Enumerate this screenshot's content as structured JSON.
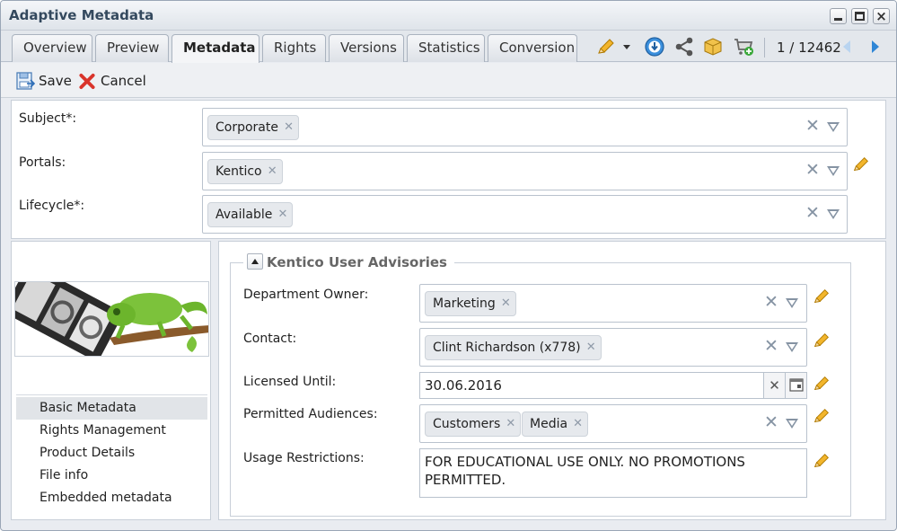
{
  "window": {
    "title": "Adaptive Metadata"
  },
  "tabs": [
    "Overview",
    "Preview",
    "Metadata",
    "Rights",
    "Versions",
    "Statistics",
    "Conversion"
  ],
  "active_tab": "Metadata",
  "pager": {
    "text": "1 / 12462"
  },
  "toolbar": {
    "save_label": "Save",
    "cancel_label": "Cancel"
  },
  "top_fields": {
    "subject": {
      "label": "Subject*:",
      "tags": [
        "Corporate"
      ]
    },
    "portals": {
      "label": "Portals:",
      "tags": [
        "Kentico"
      ]
    },
    "lifecycle": {
      "label": "Lifecycle*:",
      "tags": [
        "Available"
      ]
    }
  },
  "nav": {
    "items": [
      "Basic Metadata",
      "Rights Management",
      "Product Details",
      "File info",
      "Embedded metadata"
    ],
    "selected": "Basic Metadata"
  },
  "section": {
    "title": "Kentico User Advisories",
    "department_owner": {
      "label": "Department Owner:",
      "tags": [
        "Marketing"
      ]
    },
    "contact": {
      "label": "Contact:",
      "tags": [
        "Clint Richardson (x778)"
      ]
    },
    "licensed_until": {
      "label": "Licensed Until:",
      "value": "30.06.2016"
    },
    "permitted_audiences": {
      "label": "Permitted Audiences:",
      "tags": [
        "Customers",
        "Media"
      ]
    },
    "usage_restrictions": {
      "label": "Usage Restrictions:",
      "value": "FOR EDUCATIONAL USE ONLY. NO PROMOTIONS PERMITTED."
    }
  },
  "icons": {
    "titlebar": [
      "minimize-icon",
      "maximize-icon",
      "close-icon"
    ],
    "tabbar": [
      "pencil-icon",
      "chevron-down-icon",
      "download-icon",
      "share-icon",
      "package-icon",
      "cart-add-icon",
      "prev-arrow-icon",
      "next-arrow-icon"
    ],
    "toolbar": [
      "save-icon",
      "cancel-icon"
    ]
  },
  "colors": {
    "accent": "#2f86d6",
    "pencil": "#e8a400",
    "cancel": "#d9342b"
  }
}
